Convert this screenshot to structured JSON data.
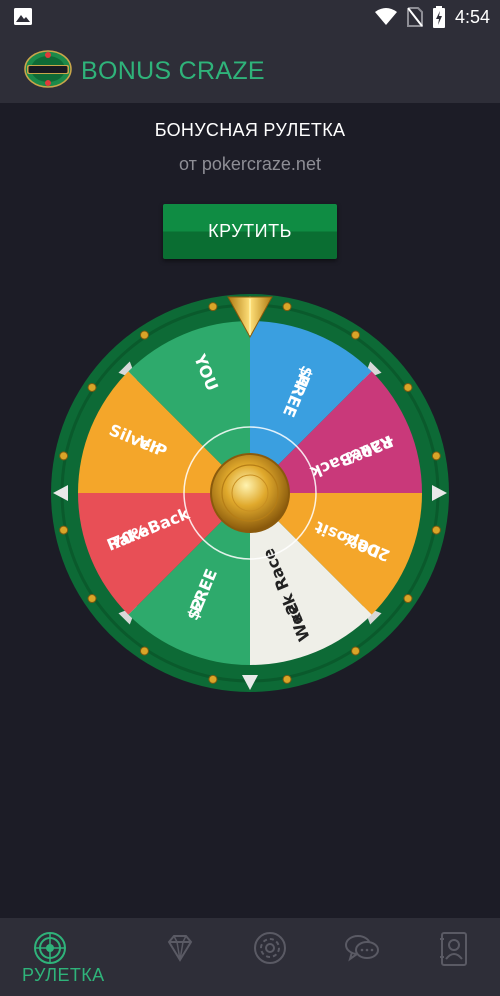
{
  "status_bar": {
    "time": "4:54",
    "icons": [
      "image-icon",
      "wifi-icon",
      "no-sim-icon",
      "battery-charging-icon"
    ]
  },
  "app_bar": {
    "title": "BONUS CRAZE",
    "logo_text": "BONUS CRAZE"
  },
  "main": {
    "heading": "БОНУСНАЯ РУЛЕТКА",
    "subheading": "от pokercraze.net",
    "spin_label": "КРУТИТЬ"
  },
  "wheel": {
    "segments": [
      {
        "line1": "$4",
        "line2": "FREE",
        "color": "#3a9fe0",
        "text_color": "#ffffff"
      },
      {
        "line1": "+20%",
        "line2": "RakeBack",
        "color": "#c9397a",
        "text_color": "#ffffff"
      },
      {
        "line1": "200%",
        "line2": "Deposit",
        "color": "#f4a62a",
        "text_color": "#ffffff"
      },
      {
        "line1": "x2",
        "line2": "Week Race",
        "color": "#efefe8",
        "text_color": "#222222"
      },
      {
        "line1": "$2",
        "line2": "FREE",
        "color": "#2eaa6c",
        "text_color": "#ffffff"
      },
      {
        "line1": "70%",
        "line2": "RakeBack",
        "color": "#e84f56",
        "text_color": "#ffffff"
      },
      {
        "line1": "Silver",
        "line2": "VIP",
        "color": "#f4a62a",
        "text_color": "#ffffff"
      },
      {
        "line1": "YOU",
        "line2": "",
        "color": "#2eaa6c",
        "text_color": "#ffffff"
      }
    ],
    "rim_color": "#0d6a36",
    "accent_gold": "#d9a528"
  },
  "bottom_nav": {
    "items": [
      {
        "label": "РУЛЕТКА",
        "icon": "roulette-icon",
        "active": true
      },
      {
        "label": "",
        "icon": "diamond-icon",
        "active": false
      },
      {
        "label": "",
        "icon": "poker-chip-icon",
        "active": false
      },
      {
        "label": "",
        "icon": "chat-icon",
        "active": false
      },
      {
        "label": "",
        "icon": "contact-card-icon",
        "active": false
      }
    ]
  }
}
